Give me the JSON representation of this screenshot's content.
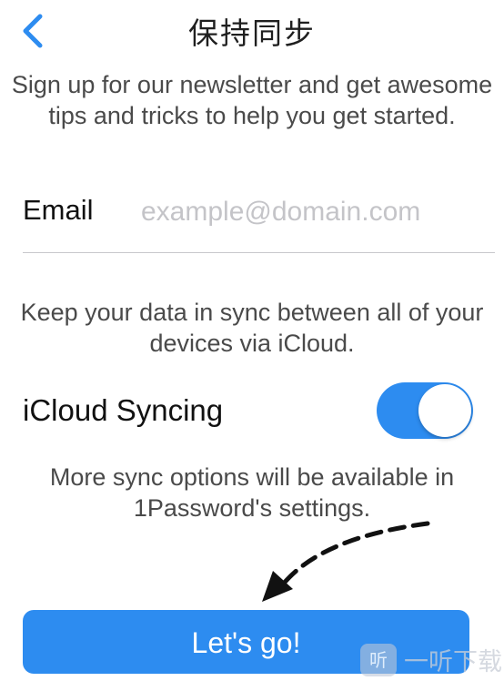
{
  "nav": {
    "title": "保持同步",
    "back_icon": "chevron-left-icon"
  },
  "newsletter": {
    "text": "Sign up for our newsletter and get awesome tips and tricks to help you get started."
  },
  "email": {
    "label": "Email",
    "placeholder": "example@domain.com",
    "value": ""
  },
  "icloud": {
    "description": "Keep your data in sync between all of your devices via iCloud.",
    "label": "iCloud Syncing",
    "enabled": true,
    "note": "More sync options will be available in 1Password's settings."
  },
  "actions": {
    "go_label": "Let's go!"
  },
  "watermark": {
    "icon_glyph": "听",
    "text": "一听下载"
  },
  "colors": {
    "accent": "#2d8cf0",
    "arrow": "#111111"
  }
}
